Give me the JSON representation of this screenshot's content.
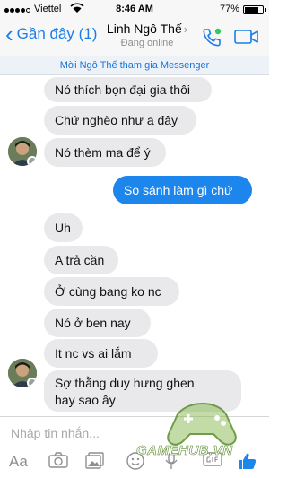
{
  "status_bar": {
    "carrier": "Viettel",
    "time": "8:46 AM",
    "battery_percent": "77%",
    "battery_level": 0.77
  },
  "header": {
    "back_label": "Gần đây (1)",
    "contact_name": "Linh Ngô Thế",
    "contact_status": "Đang online"
  },
  "invite_banner": "Mời Ngô Thế tham gia Messenger",
  "messages": [
    {
      "sender": "them",
      "text": "Nó thích bọn đại gia thôi"
    },
    {
      "sender": "them",
      "text": "Chứ nghèo như a đây"
    },
    {
      "sender": "them",
      "text": "Nó thèm ma để ý"
    },
    {
      "sender": "me",
      "text": "So sánh làm gì chứ"
    },
    {
      "sender": "them",
      "text": "Uh"
    },
    {
      "sender": "them",
      "text": "A trả cần"
    },
    {
      "sender": "them",
      "text": "Ở cùng bang ko nc"
    },
    {
      "sender": "them",
      "text": "Nó ở ben nay"
    },
    {
      "sender": "them",
      "text": "It nc vs ai lắm"
    },
    {
      "sender": "them",
      "text_lines": [
        "Sợ thằng duy hưng ghen",
        "hay sao ây"
      ]
    }
  ],
  "composer": {
    "placeholder": "Nhập tin nhắn..."
  },
  "toolbar": {
    "aa_label": "Aa",
    "icons": [
      "text-format-icon",
      "camera-icon",
      "gallery-icon",
      "sticker-icon",
      "gif-icon",
      "microphone-icon",
      "location-icon",
      "like-icon"
    ]
  },
  "watermark": {
    "text": "GAMEHUB.VN"
  },
  "colors": {
    "accent": "#1d86ec",
    "incoming_bubble": "#e9e9eb",
    "banner_text": "#1a74d6"
  }
}
